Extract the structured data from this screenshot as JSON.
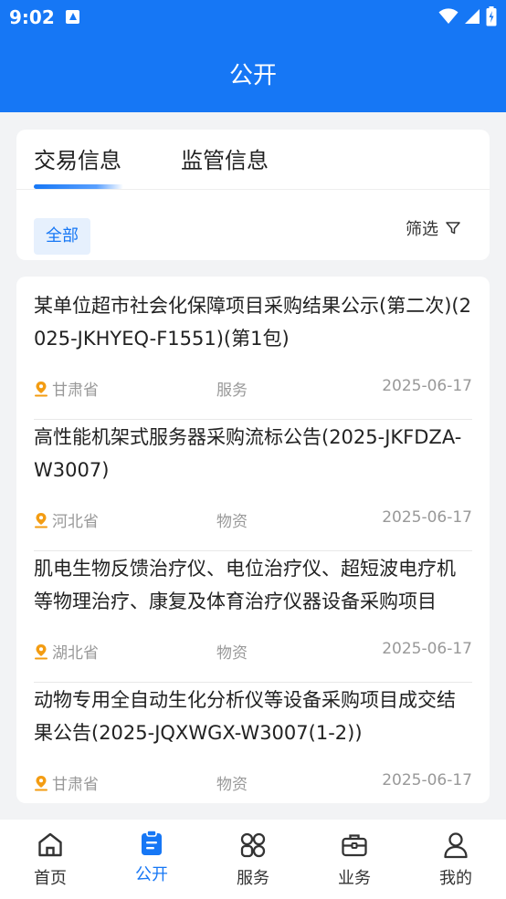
{
  "status_bar": {
    "time": "9:02"
  },
  "header": {
    "title": "公开"
  },
  "tabs": [
    {
      "label": "交易信息"
    },
    {
      "label": "监管信息"
    }
  ],
  "filter_chip": "全部",
  "filter_label": "筛选",
  "items": [
    {
      "title": "某单位超市社会化保障项目采购结果公示(第二次)(2025-JKHYEQ-F1551)(第1包)",
      "region": "甘肃省",
      "category": "服务",
      "date": "2025-06-17"
    },
    {
      "title": "高性能机架式服务器采购流标公告(2025-JKFDZA-W3007)",
      "region": "河北省",
      "category": "物资",
      "date": "2025-06-17"
    },
    {
      "title": "肌电生物反馈治疗仪、电位治疗仪、超短波电疗机等物理治疗、康复及体育治疗仪器设备采购项目",
      "region": "湖北省",
      "category": "物资",
      "date": "2025-06-17"
    },
    {
      "title": "动物专用全自动生化分析仪等设备采购项目成交结果公告(2025-JQXWGX-W3007(1-2))",
      "region": "甘肃省",
      "category": "物资",
      "date": "2025-06-17"
    }
  ],
  "tabbar": [
    {
      "label": "首页",
      "icon": "home-icon"
    },
    {
      "label": "公开",
      "icon": "clipboard-icon"
    },
    {
      "label": "服务",
      "icon": "apps-icon"
    },
    {
      "label": "业务",
      "icon": "briefcase-icon"
    },
    {
      "label": "我的",
      "icon": "user-icon"
    }
  ],
  "colors": {
    "primary": "#1677f5",
    "location": "#f39c12"
  }
}
